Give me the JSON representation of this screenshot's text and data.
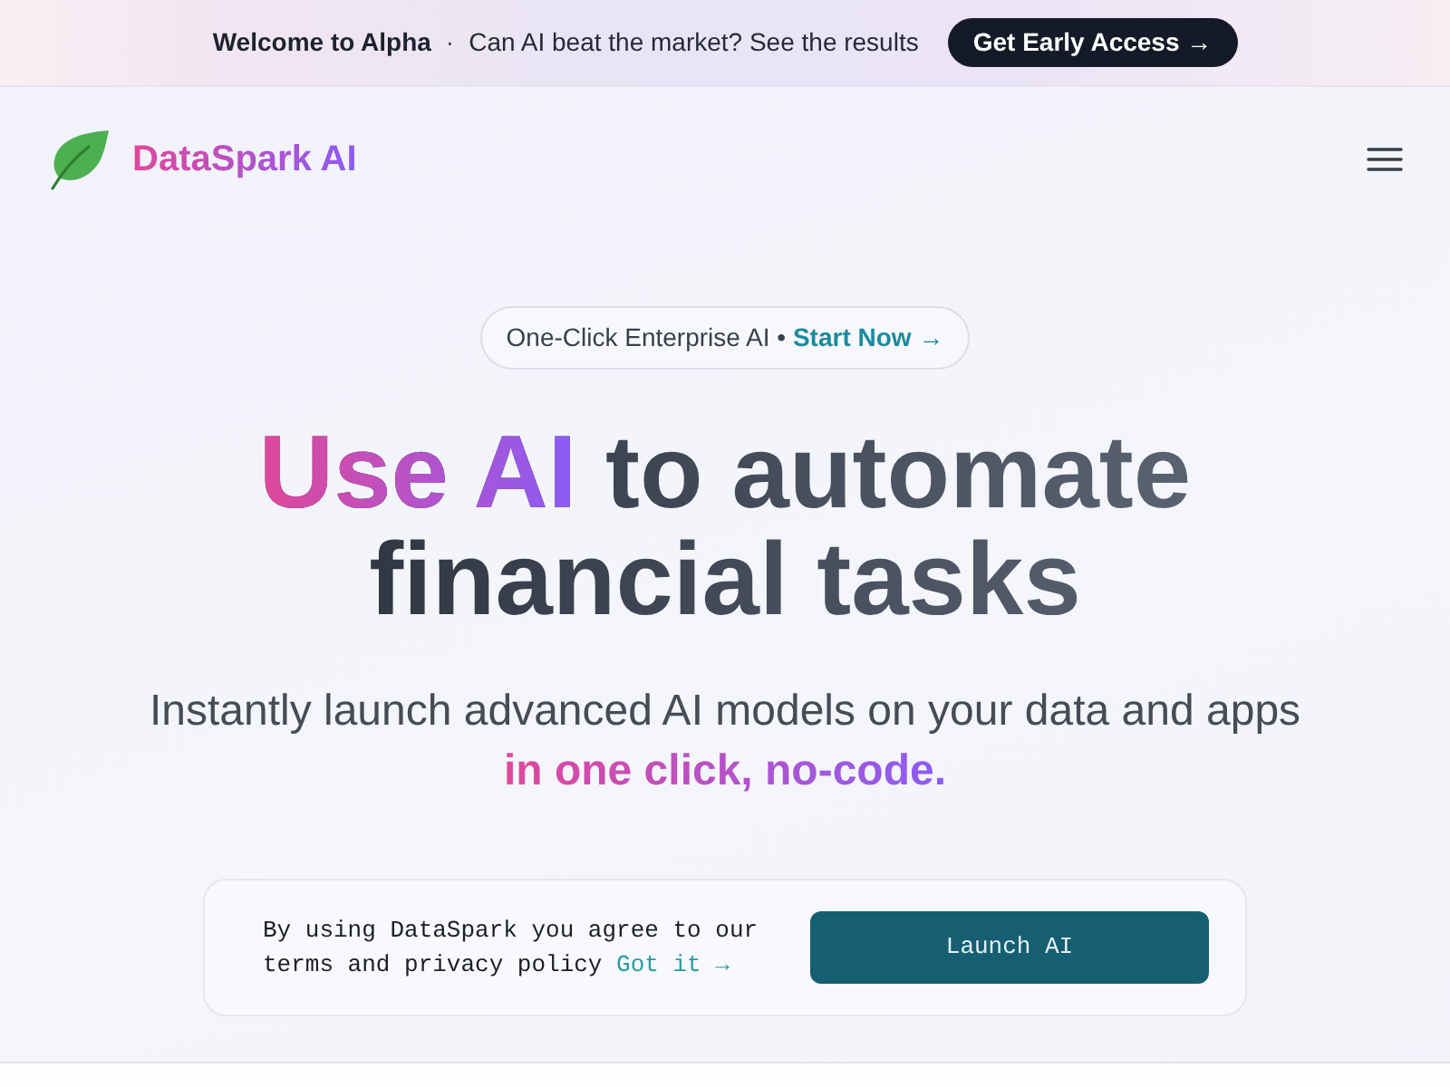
{
  "announcement": {
    "title": "Welcome to Alpha",
    "separator": "·",
    "message": "Can AI beat the market? See the results",
    "button": "Get Early Access →"
  },
  "navbar": {
    "brand": "DataSpark AI"
  },
  "hero": {
    "pill": {
      "text": "One-Click Enterprise AI •",
      "link": "Start Now →"
    },
    "heading": {
      "highlight": "Use AI",
      "line_1_rest": "to automate",
      "line_2": "financial tasks"
    },
    "subtitle": "Instantly launch advanced AI models on your data and apps **in one click, no-code.**"
  },
  "consent": {
    "text": "By using DataSpark you agree to our terms and privacy policy",
    "link": "Got it →",
    "button": "Launch AI"
  }
}
